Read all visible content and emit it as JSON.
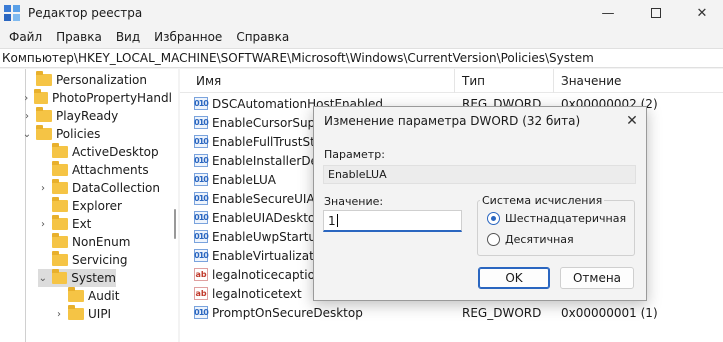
{
  "window": {
    "title": "Редактор реестра",
    "minimize": "—",
    "close": "✕"
  },
  "menu": [
    "Файл",
    "Правка",
    "Вид",
    "Избранное",
    "Справка"
  ],
  "address": "Компьютер\\HKEY_LOCAL_MACHINE\\SOFTWARE\\Microsoft\\Windows\\CurrentVersion\\Policies\\System",
  "tree": [
    {
      "label": "Personalization",
      "chevron": ""
    },
    {
      "label": "PhotoPropertyHandl",
      "chevron": "›"
    },
    {
      "label": "PlayReady",
      "chevron": "›"
    },
    {
      "label": "Policies",
      "chevron": "⌄"
    },
    {
      "label": "ActiveDesktop",
      "chevron": ""
    },
    {
      "label": "Attachments",
      "chevron": ""
    },
    {
      "label": "DataCollection",
      "chevron": "›"
    },
    {
      "label": "Explorer",
      "chevron": ""
    },
    {
      "label": "Ext",
      "chevron": "›"
    },
    {
      "label": "NonEnum",
      "chevron": ""
    },
    {
      "label": "Servicing",
      "chevron": ""
    },
    {
      "label": "System",
      "chevron": "⌄",
      "selected": true
    },
    {
      "label": "Audit",
      "chevron": ""
    },
    {
      "label": "UIPI",
      "chevron": "›"
    }
  ],
  "list": {
    "columns": {
      "name": "Имя",
      "type": "Тип",
      "data": "Значение"
    },
    "rows": [
      {
        "icon": "bin",
        "name": "DSCAutomationHostEnabled",
        "type": "REG_DWORD",
        "data": "0x00000002 (2)"
      },
      {
        "icon": "bin",
        "name": "EnableCursorSuppression",
        "type": "",
        "data": ""
      },
      {
        "icon": "bin",
        "name": "EnableFullTrustStartupTasks",
        "type": "",
        "data": ""
      },
      {
        "icon": "bin",
        "name": "EnableInstallerDetection",
        "type": "",
        "data": ""
      },
      {
        "icon": "bin",
        "name": "EnableLUA",
        "type": "",
        "data": ""
      },
      {
        "icon": "bin",
        "name": "EnableSecureUIAPaths",
        "type": "",
        "data": ""
      },
      {
        "icon": "bin",
        "name": "EnableUIADesktopToggle",
        "type": "",
        "data": ""
      },
      {
        "icon": "bin",
        "name": "EnableUwpStartupTasks",
        "type": "",
        "data": ""
      },
      {
        "icon": "bin",
        "name": "EnableVirtualization",
        "type": "",
        "data": ""
      },
      {
        "icon": "str",
        "name": "legalnoticecaption",
        "type": "",
        "data": ""
      },
      {
        "icon": "str",
        "name": "legalnoticetext",
        "type": "",
        "data": ""
      },
      {
        "icon": "bin",
        "name": "PromptOnSecureDesktop",
        "type": "REG_DWORD",
        "data": "0x00000001 (1)"
      }
    ]
  },
  "dialog": {
    "title": "Изменение параметра DWORD (32 бита)",
    "close": "✕",
    "param_label": "Параметр:",
    "param_value": "EnableLUA",
    "value_label": "Значение:",
    "value": "1",
    "base_label": "Система исчисления",
    "hex_label": "Шестнадцатеричная",
    "dec_label": "Десятичная",
    "ok": "OK",
    "cancel": "Отмена"
  },
  "icons": {
    "bin_glyph": "010",
    "str_glyph": "ab"
  },
  "colors": {
    "accent": "#2a66c0",
    "folder": "#f5c445"
  }
}
